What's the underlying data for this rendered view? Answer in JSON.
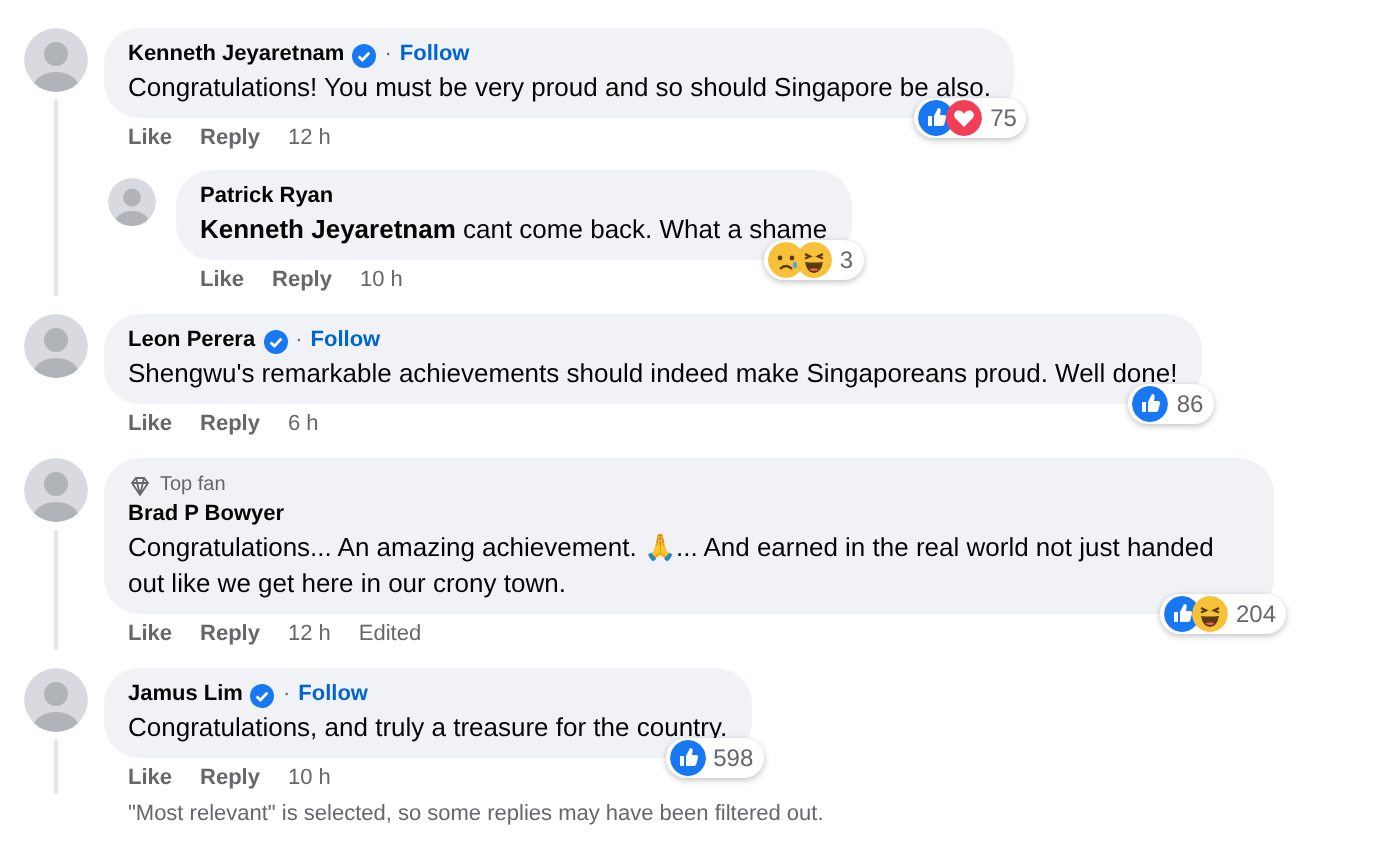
{
  "comments": [
    {
      "name": "Kenneth Jeyaretnam",
      "verified": true,
      "separator": "·",
      "follow": "Follow",
      "text": "Congratulations! You must be very proud and so should Singapore be also.",
      "actions": [
        "Like",
        "Reply"
      ],
      "time": "12 h",
      "reactions": [
        {
          "kind": "like"
        },
        {
          "kind": "love"
        }
      ],
      "count": "75",
      "thread_line": true,
      "replies": [
        {
          "name": "Patrick Ryan",
          "text": "**Kenneth Jeyaretnam** cant come back. What a shame",
          "actions": [
            "Like",
            "Reply"
          ],
          "time": "10 h",
          "reactions": [
            {
              "kind": "sad"
            },
            {
              "kind": "haha"
            }
          ],
          "count": "3"
        }
      ]
    },
    {
      "name": "Leon Perera",
      "verified": true,
      "separator": "·",
      "follow": "Follow",
      "text": "Shengwu's remarkable achievements should indeed make Singaporeans proud. Well done!",
      "actions": [
        "Like",
        "Reply"
      ],
      "time": "6 h",
      "reactions": [
        {
          "kind": "like"
        }
      ],
      "count": "86",
      "thread_line": false
    },
    {
      "name": "Brad P Bowyer",
      "verified": false,
      "top_fan": "Top fan",
      "text": "Congratulations... An amazing achievement. 🙏... And earned in the real world not just handed out like we get here in our crony town.",
      "actions": [
        "Like",
        "Reply"
      ],
      "time": "12 h",
      "edited": "Edited",
      "reactions": [
        {
          "kind": "like"
        },
        {
          "kind": "haha"
        }
      ],
      "count": "204",
      "thread_line": true
    },
    {
      "name": "Jamus Lim",
      "verified": true,
      "separator": "·",
      "follow": "Follow",
      "text": "Congratulations, and truly a treasure for the country.",
      "actions": [
        "Like",
        "Reply"
      ],
      "time": "10 h",
      "reactions": [
        {
          "kind": "like"
        }
      ],
      "count": "598",
      "thread_line": true
    }
  ],
  "filter_note": "\"Most relevant\" is selected, so some replies may have been filtered out."
}
